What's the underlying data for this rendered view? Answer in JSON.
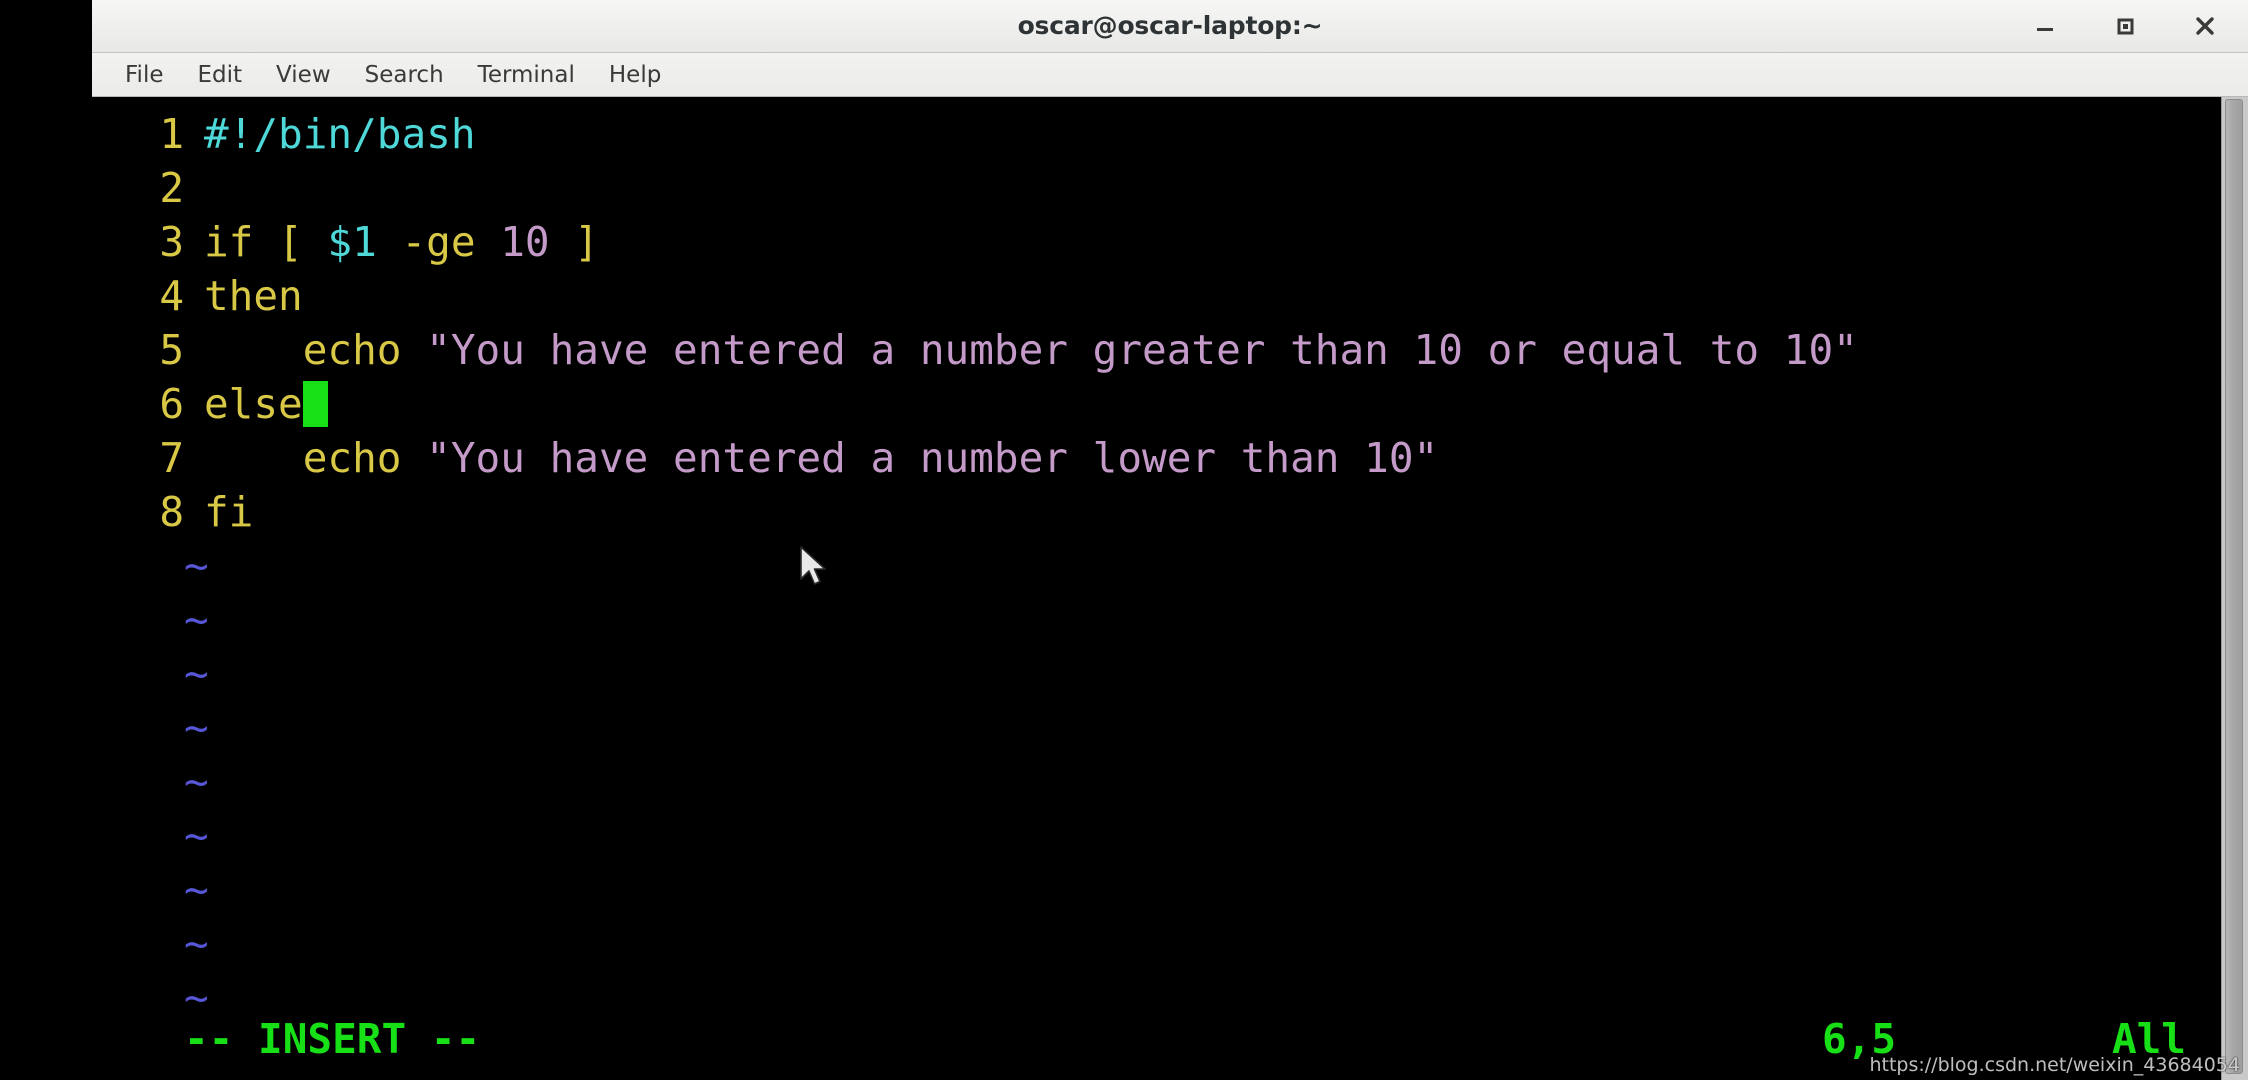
{
  "window": {
    "title": "oscar@oscar-laptop:~",
    "controls": [
      {
        "name": "minimize-button",
        "glyph": "minimize"
      },
      {
        "name": "maximize-button",
        "glyph": "maximize"
      },
      {
        "name": "close-button",
        "glyph": "close"
      }
    ]
  },
  "menubar": {
    "items": [
      {
        "label": "File"
      },
      {
        "label": "Edit"
      },
      {
        "label": "View"
      },
      {
        "label": "Search"
      },
      {
        "label": "Terminal"
      },
      {
        "label": "Help"
      }
    ]
  },
  "editor": {
    "program": "vim",
    "lines": [
      {
        "num": "1",
        "segments": [
          {
            "text": "#!/bin/bash",
            "color": "cyan"
          }
        ]
      },
      {
        "num": "2",
        "segments": []
      },
      {
        "num": "3",
        "segments": [
          {
            "text": "if [ ",
            "color": "yellow"
          },
          {
            "text": "$1",
            "color": "cyan"
          },
          {
            "text": " -ge ",
            "color": "yellow"
          },
          {
            "text": "10",
            "color": "purple"
          },
          {
            "text": " ]",
            "color": "yellow"
          }
        ]
      },
      {
        "num": "4",
        "segments": [
          {
            "text": "then",
            "color": "yellow"
          }
        ]
      },
      {
        "num": "5",
        "segments": [
          {
            "text": "    echo ",
            "color": "yellow"
          },
          {
            "text": "\"You have entered a number greater than 10 or equal to 10\"",
            "color": "purple"
          }
        ]
      },
      {
        "num": "6",
        "segments": [
          {
            "text": "else",
            "color": "yellow"
          }
        ],
        "cursor_after": true
      },
      {
        "num": "7",
        "segments": [
          {
            "text": "    echo ",
            "color": "yellow"
          },
          {
            "text": "\"You have entered a number lower than 10\"",
            "color": "purple"
          }
        ]
      },
      {
        "num": "8",
        "segments": [
          {
            "text": "fi",
            "color": "yellow"
          }
        ]
      }
    ],
    "filler_char": "~",
    "filler_count": 9,
    "cursor": {
      "line": 6,
      "col": 5,
      "style": "block",
      "color": "#17e017"
    }
  },
  "statusline": {
    "mode": "-- INSERT --",
    "position": "6,5",
    "scroll": "All"
  },
  "watermark": {
    "text": "https://blog.csdn.net/weixin_43684054"
  },
  "colors": {
    "background": "#000000",
    "line_number": "#d8c846",
    "cyan": "#4fd8d8",
    "yellow": "#d8c846",
    "purple": "#c49ac9",
    "tilde_blue": "#5656d6",
    "status_green": "#17e017",
    "titlebar": "#eeeeec"
  }
}
